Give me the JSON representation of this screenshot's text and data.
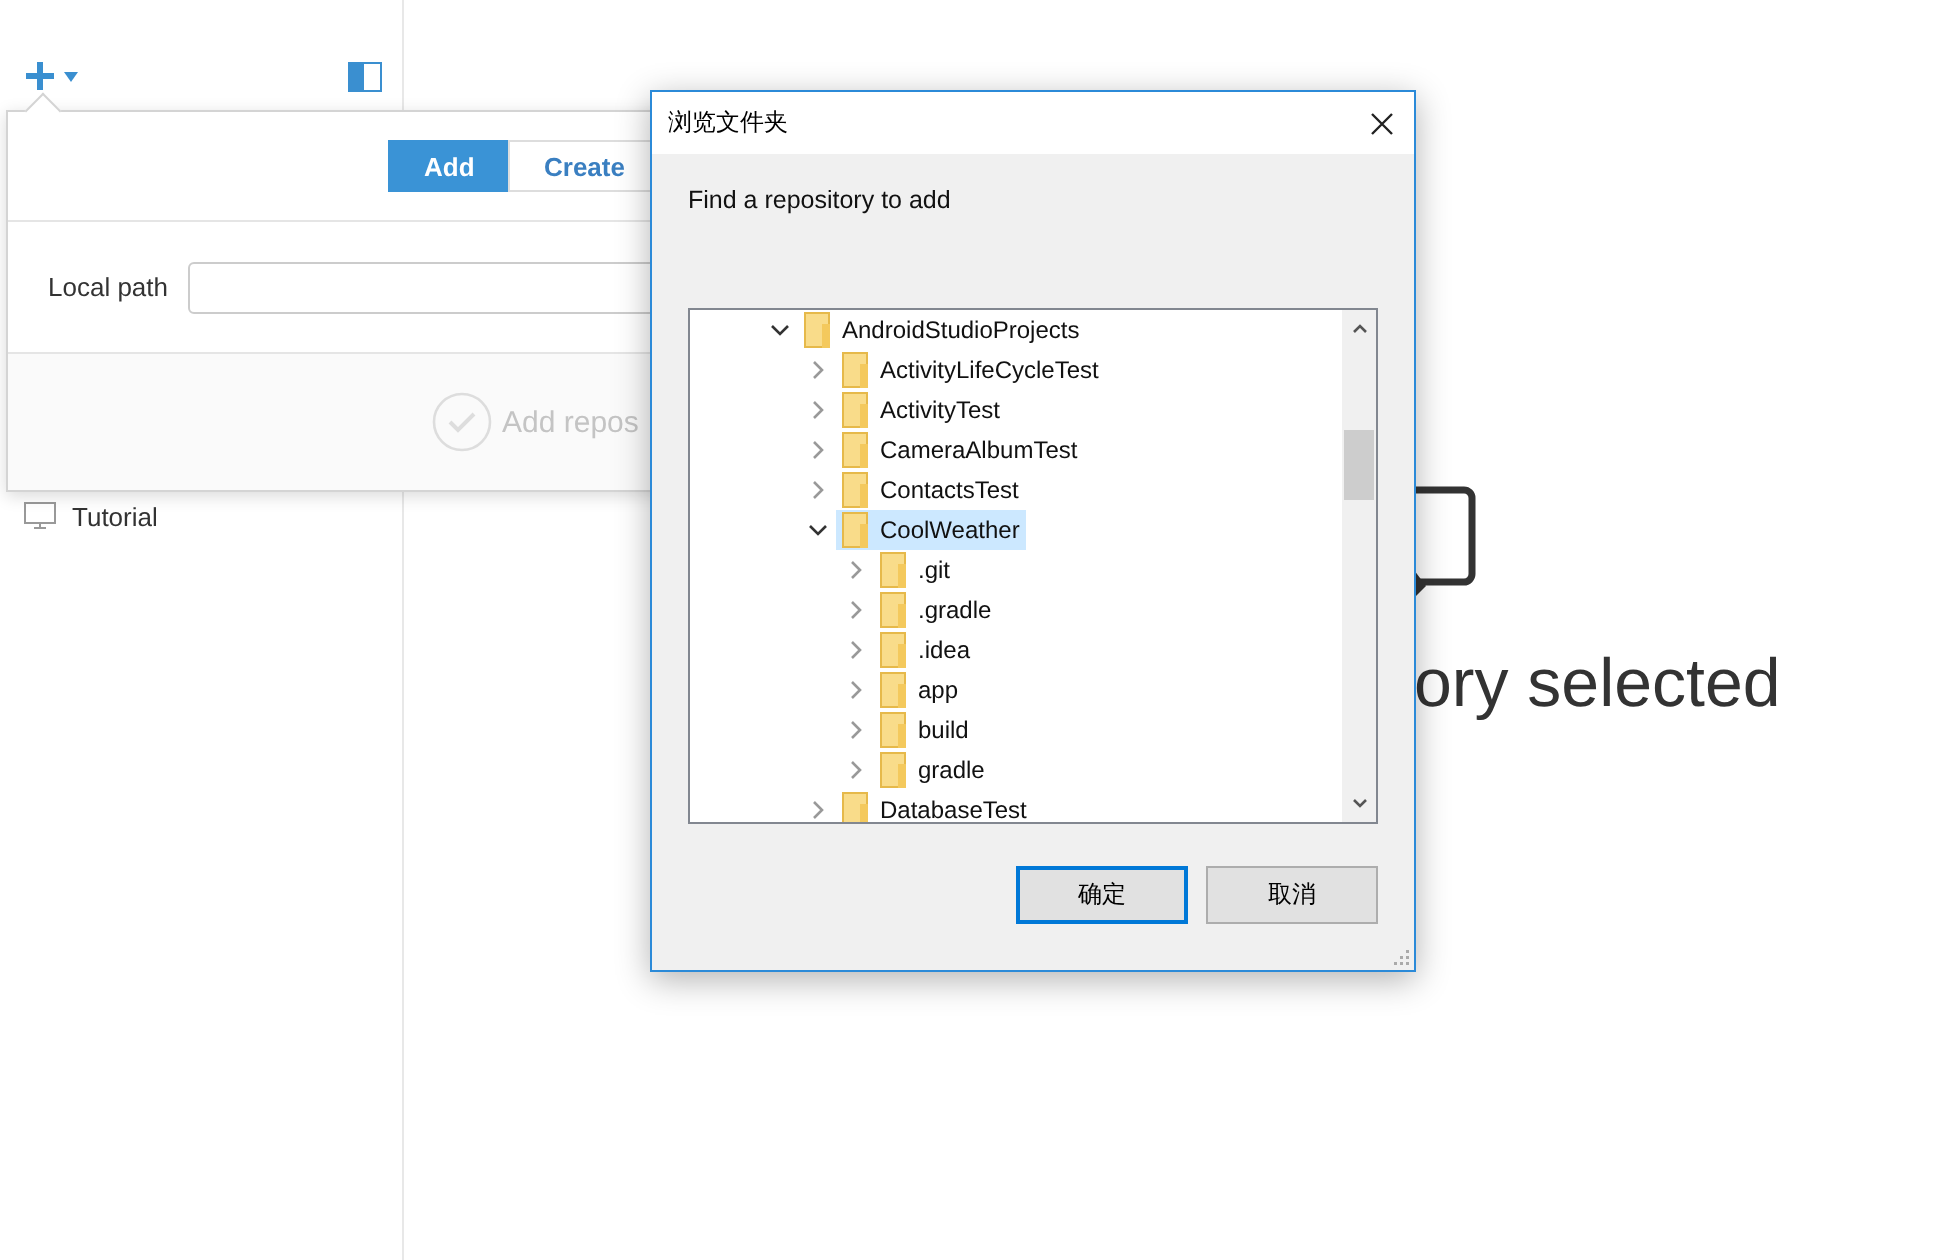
{
  "sidebar": {
    "repositories": [
      {
        "name": "Tutorial"
      }
    ]
  },
  "add_popover": {
    "tabs": [
      {
        "label": "Add",
        "selected": true
      },
      {
        "label": "Create",
        "selected": false
      }
    ],
    "local_path": {
      "label": "Local path"
    },
    "submit": "Add repos"
  },
  "main": {
    "empty_message": "ory selected"
  },
  "dialog": {
    "title": "浏览文件夹",
    "prompt": "Find a repository to add",
    "tree": [
      {
        "name": "AndroidStudioProjects",
        "expanded": true,
        "selected": false,
        "children": [
          {
            "name": "ActivityLifeCycleTest",
            "expanded": false,
            "selected": false
          },
          {
            "name": "ActivityTest",
            "expanded": false,
            "selected": false
          },
          {
            "name": "CameraAlbumTest",
            "expanded": false,
            "selected": false
          },
          {
            "name": "ContactsTest",
            "expanded": false,
            "selected": false
          },
          {
            "name": "CoolWeather",
            "expanded": true,
            "selected": true,
            "children": [
              {
                "name": ".git",
                "expanded": false,
                "selected": false
              },
              {
                "name": ".gradle",
                "expanded": false,
                "selected": false
              },
              {
                "name": ".idea",
                "expanded": false,
                "selected": false
              },
              {
                "name": "app",
                "expanded": false,
                "selected": false
              },
              {
                "name": "build",
                "expanded": false,
                "selected": false
              },
              {
                "name": "gradle",
                "expanded": false,
                "selected": false
              }
            ]
          },
          {
            "name": "DatabaseTest",
            "expanded": false,
            "selected": false
          }
        ]
      }
    ],
    "buttons": [
      {
        "label": "确定",
        "default": true
      },
      {
        "label": "取消",
        "default": false
      }
    ]
  }
}
